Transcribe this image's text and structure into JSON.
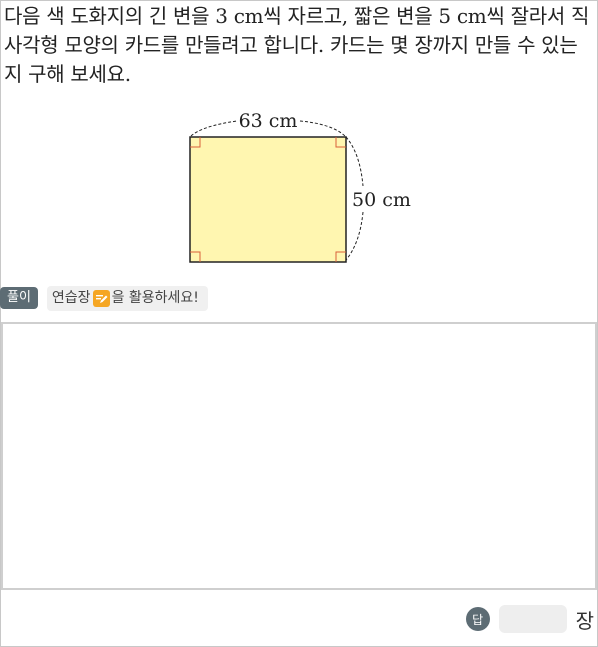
{
  "question": {
    "text": "다음 색 도화지의 긴 변을 3 cm씩 자르고, 짧은 변을 5 cm씩 잘라서 직사각형 모양의 카드를 만들려고 합니다. 카드는 몇 장까지 만들 수 있는지 구해 보세요."
  },
  "figure": {
    "width_label": "63 cm",
    "height_label": "50 cm",
    "fill_color": "#fff6b0",
    "corner_mark_color": "#d9603a"
  },
  "solution": {
    "badge_label": "풀이",
    "hint_before": "연습장",
    "hint_icon": "pencil-icon",
    "hint_after": "을 활용하세요!"
  },
  "answer": {
    "badge_label": "답",
    "value": "",
    "unit": "장"
  }
}
